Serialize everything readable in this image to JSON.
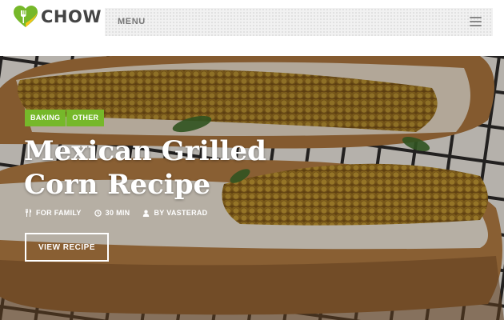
{
  "brand": {
    "name": "CHOW",
    "colors": {
      "green": "#76b82a",
      "yellow": "#f5c518"
    }
  },
  "nav": {
    "menu_label": "MENU"
  },
  "hero": {
    "tags": [
      "BAKING",
      "OTHER"
    ],
    "title": "Mexican Grilled Corn Recipe",
    "meta": {
      "audience": "FOR FAMILY",
      "time": "30 MIN",
      "author": "BY VASTERAD"
    },
    "cta_label": "VIEW RECIPE"
  }
}
